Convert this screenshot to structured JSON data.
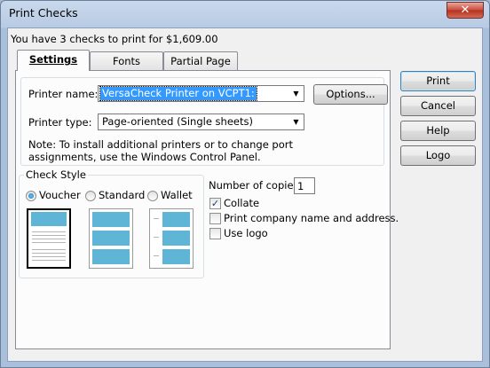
{
  "window": {
    "title": "Print Checks",
    "close_glyph": "✕"
  },
  "summary": "You have 3 checks to print for $1,609.00",
  "tabs": [
    {
      "label": "Settings",
      "active": true
    },
    {
      "label": "Fonts",
      "active": false
    },
    {
      "label": "Partial Page",
      "active": false
    }
  ],
  "printer": {
    "name_label": "Printer name:",
    "name_value": "VersaCheck Printer on VCPT1:",
    "type_label": "Printer type:",
    "type_value": "Page-oriented (Single sheets)",
    "options_label": "Options...",
    "note_line1": "Note: To install additional printers or to change port",
    "note_line2": "assignments, use the Windows Control Panel."
  },
  "check_style": {
    "group_label": "Check Style",
    "options": [
      {
        "label": "Voucher",
        "selected": true
      },
      {
        "label": "Standard",
        "selected": false
      },
      {
        "label": "Wallet",
        "selected": false
      }
    ]
  },
  "copies": {
    "label": "Number of copies:",
    "value": "1"
  },
  "checkboxes": [
    {
      "label": "Collate",
      "checked": true
    },
    {
      "label": "Print company name and address.",
      "checked": false
    },
    {
      "label": "Use logo",
      "checked": false
    }
  ],
  "buttons": {
    "print": "Print",
    "cancel": "Cancel",
    "help": "Help",
    "logo": "Logo"
  },
  "colors": {
    "selection": "#3399ff",
    "check_stub": "#5fb5d6",
    "title_bar": "#b8cbe4"
  }
}
